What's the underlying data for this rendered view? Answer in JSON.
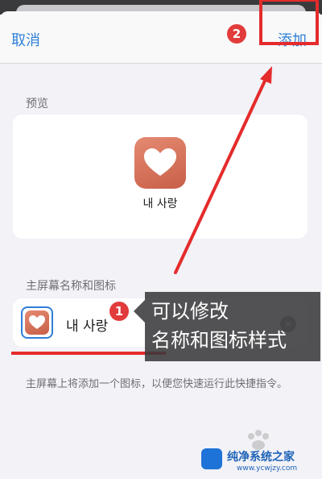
{
  "navbar": {
    "cancel_label": "取消",
    "add_label": "添加"
  },
  "preview": {
    "section_label": "预览",
    "app_name": "내 사랑",
    "icon": "heart-icon"
  },
  "home_screen": {
    "section_label": "主屏幕名称和图标",
    "name_value": "내 사랑",
    "description": "主屏幕上将添加一个图标，以便您快速运行此快捷指令。"
  },
  "annotations": {
    "marker_1": "1",
    "marker_2": "2",
    "callout_line1": "可以修改",
    "callout_line2": "名称和图标样式"
  },
  "watermark": {
    "title": "纯净系统之家",
    "subtitle": "www.ycwjzy.com"
  },
  "colors": {
    "accent": "#2f7fd8",
    "highlight_red": "#e52b2b",
    "icon_gradient": [
      "#e58a72",
      "#c85f48"
    ]
  }
}
